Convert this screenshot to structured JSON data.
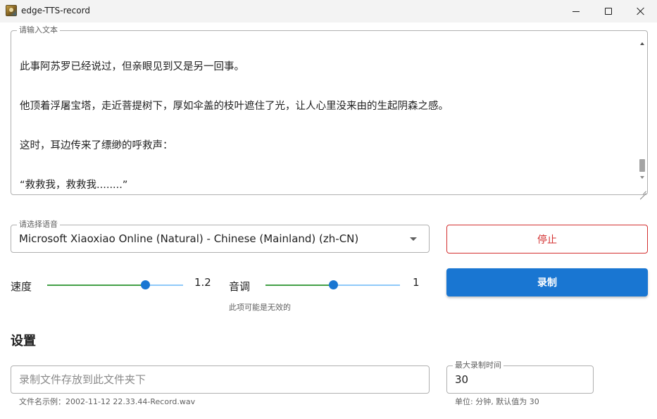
{
  "window": {
    "title": "edge-TTS-record",
    "icon": "app-icon"
  },
  "text_input": {
    "legend": "请输入文本",
    "paragraphs": [
      "此事阿苏罗已经说过，但亲眼见到又是另一回事。",
      "他顶着浮屠宝塔，走近菩提树下，厚如伞盖的枝叶遮住了光，让人心里没来由的生起阴森之感。",
      "这时，耳边传来了缥缈的呼救声：",
      "“救救我，救救我........”"
    ]
  },
  "voice": {
    "legend": "请选择语音",
    "selected": "Microsoft Xiaoxiao Online (Natural) - Chinese (Mainland) (zh-CN)"
  },
  "buttons": {
    "stop_label": "停止",
    "record_label": "录制",
    "stop_color": "#d32f2f",
    "record_color": "#1976d2"
  },
  "speed": {
    "label": "速度",
    "value": "1.2",
    "fraction": 0.72
  },
  "pitch": {
    "label": "音调",
    "value": "1",
    "fraction": 0.5,
    "hint": "此项可能是无效的"
  },
  "settings": {
    "title": "设置",
    "folder": {
      "placeholder": "录制文件存放到此文件夹下",
      "helper": "文件名示例：2002-11-12 22.33.44-Record.wav"
    },
    "max_time": {
      "legend": "最大录制时间",
      "value": "30",
      "helper": "单位: 分钟, 默认值为 30"
    }
  },
  "colors": {
    "slider_fill": "#43a047",
    "slider_rail": "#90caf9",
    "slider_thumb": "#1976d2"
  }
}
